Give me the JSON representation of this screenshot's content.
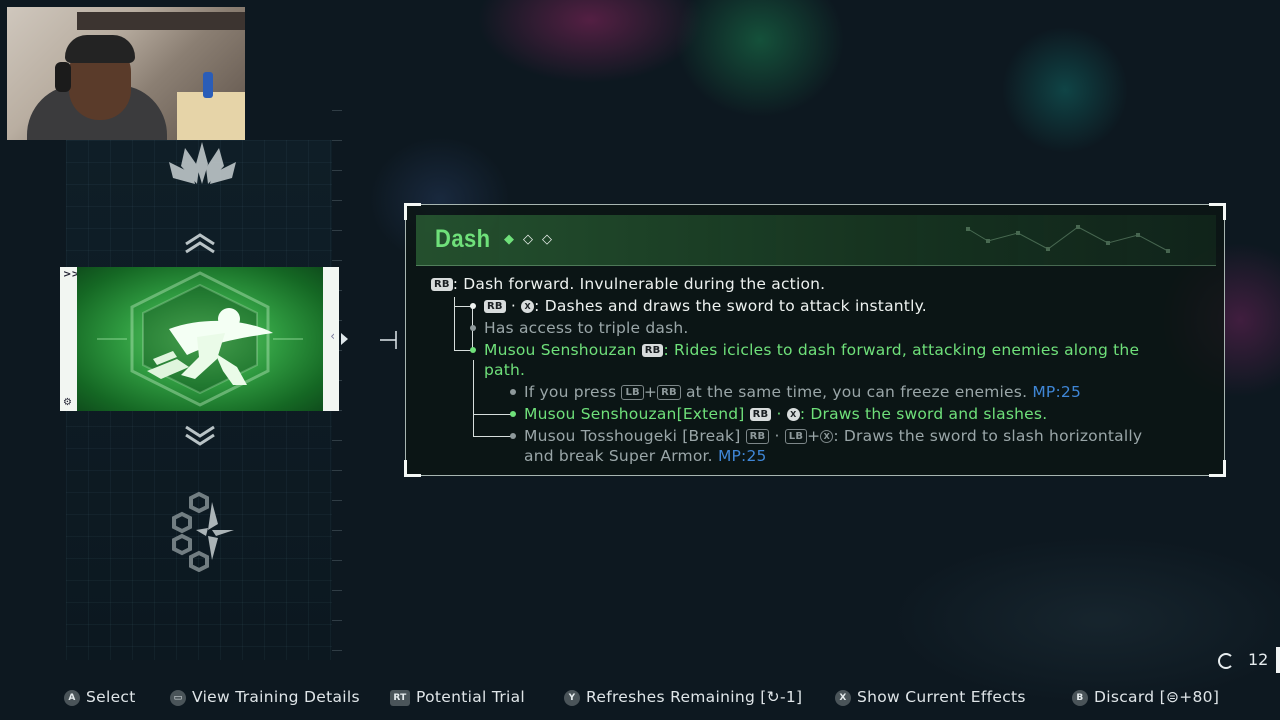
{
  "panel": {
    "title": "Dash",
    "rank": {
      "filled": 1,
      "total": 3
    },
    "lines": {
      "l1_key": "RB",
      "l1_text": ": Dash forward. Invulnerable during the action.",
      "l2_key": "RB",
      "l2_sep": "·",
      "l2_btn": "X",
      "l2_text": ": Dashes and draws the sword to attack instantly.",
      "l3_text": "Has access to triple dash.",
      "l4_name": "Musou Senshouzan",
      "l4_key": "RB",
      "l4_text": ": Rides icicles to dash forward, attacking enemies along the",
      "l4b_text": "path.",
      "l5_pre": "If you press",
      "l5_key1": "LB",
      "l5_plus": "+",
      "l5_key2": "RB",
      "l5_text": "at the same time, you can freeze enemies.",
      "l5_mp": "MP:25",
      "l6_name": "Musou Senshouzan[Extend]",
      "l6_key": "RB",
      "l6_sep": "·",
      "l6_btn": "X",
      "l6_text": ": Draws the sword and slashes.",
      "l7_name": "Musou Tosshougeki [Break]",
      "l7_key": "RB",
      "l7_sep": "·",
      "l7_key2": "LB",
      "l7_plus": "+",
      "l7_btn": "X",
      "l7_text": ": Draws the sword to slash horizontally",
      "l7b_text": "and break Super Armor.",
      "l7_mp": "MP:25"
    }
  },
  "card": {
    "top_label": ">>>",
    "side_label": "‹"
  },
  "refresh": {
    "count": "12"
  },
  "footer": {
    "select": {
      "btn": "A",
      "label": "Select"
    },
    "training": {
      "btn": "▭",
      "label": "View Training Details"
    },
    "trial": {
      "btn": "RT",
      "label": "Potential Trial"
    },
    "refreshes": {
      "btn": "Y",
      "label": "Refreshes Remaining [↻-1]"
    },
    "effects": {
      "btn": "X",
      "label": "Show Current Effects"
    },
    "discard": {
      "btn": "B",
      "label": "Discard [⊜+80]"
    }
  },
  "icons": [
    "lotus-emblem-icon",
    "chevron-up-icon",
    "chevron-down-icon",
    "dash-skill-icon",
    "flower-emblem-icon",
    "refresh-icon"
  ],
  "colors": {
    "accent_green": "#6fe07a",
    "mp_blue": "#3f86d6",
    "text_dim": "#9aa6a8"
  }
}
